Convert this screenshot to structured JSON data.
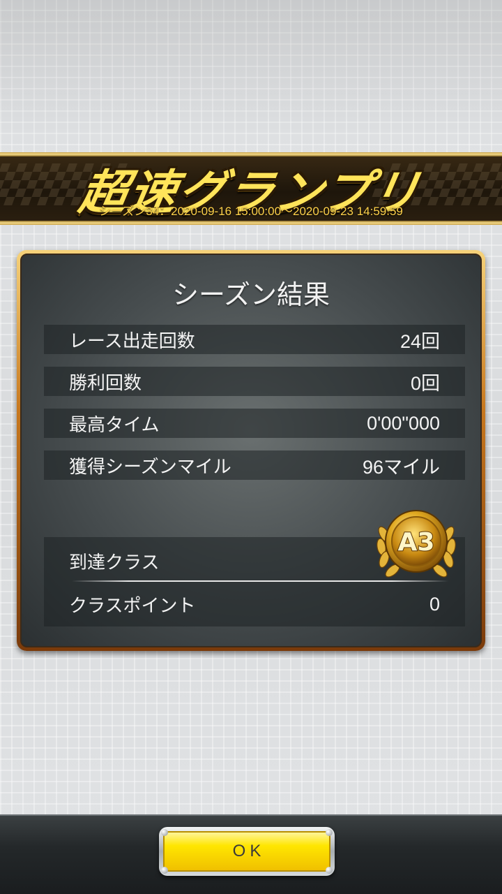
{
  "banner": {
    "logo_text": "超速グランプリ",
    "season_text": "シーズン34：2020-09-16 15:00:00〜2020-09-23 14:59:59"
  },
  "results": {
    "title": "シーズン結果",
    "rows": [
      {
        "label": "レース出走回数",
        "value": "24回"
      },
      {
        "label": "勝利回数",
        "value": "0回"
      },
      {
        "label": "最高タイム",
        "value": "0'00\"000"
      },
      {
        "label": "獲得シーズンマイル",
        "value": "96マイル"
      }
    ],
    "class": {
      "label": "到達クラス",
      "badge": "A3",
      "points_label": "クラスポイント",
      "points_value": "0"
    }
  },
  "footer": {
    "ok_label": "OK"
  },
  "colors": {
    "accent_gold": "#ffe45a",
    "button_yellow": "#ffe600",
    "panel_frame": "#c8781e"
  }
}
